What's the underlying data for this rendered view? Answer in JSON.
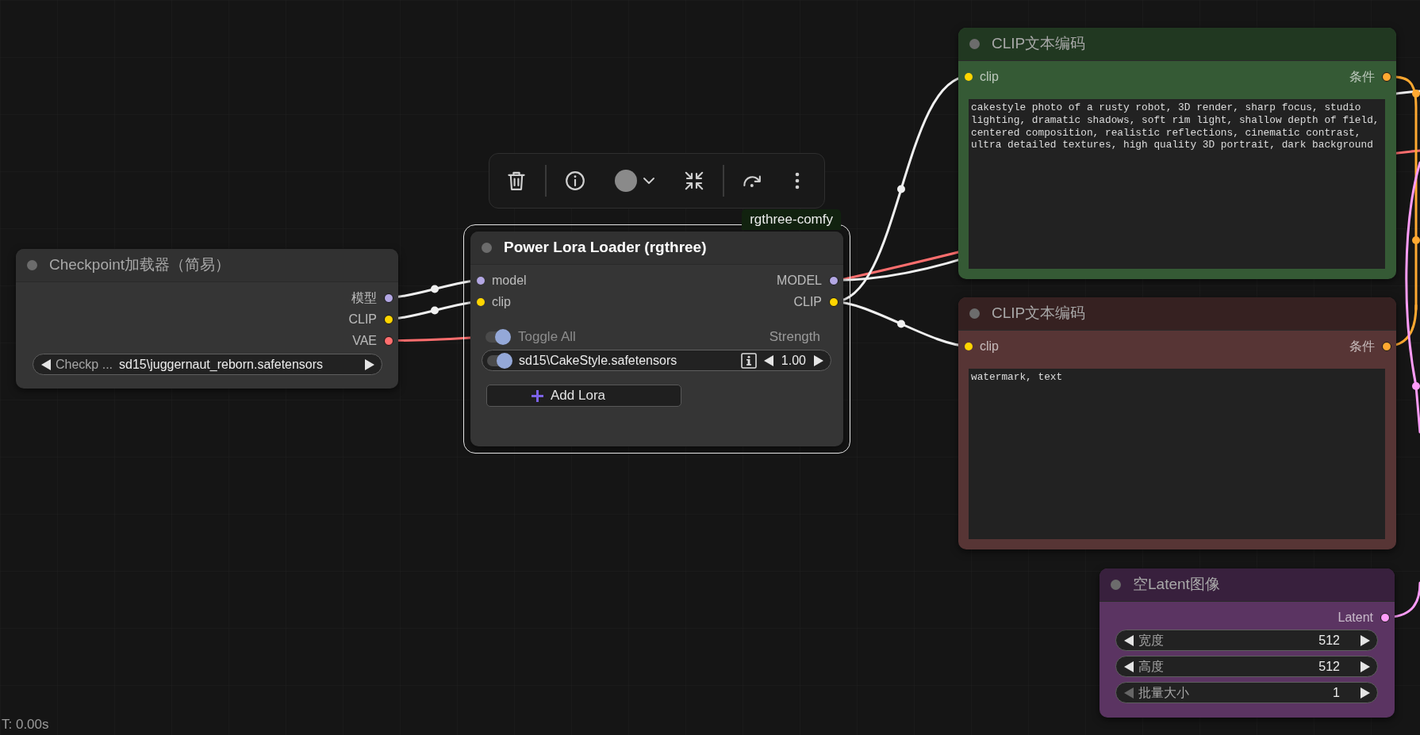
{
  "nodes": [
    {
      "title": "Checkpoint加载器（简易）",
      "selected": false,
      "outputs": [
        {
          "label": "模型",
          "color": "#b3a7e3"
        },
        {
          "label": "CLIP",
          "color": "#ffd500"
        },
        {
          "label": "VAE",
          "color": "#ff6e6e"
        }
      ],
      "widgets": [
        {
          "kind": "combo",
          "label": "Checkp ...",
          "value": "sd15\\juggernaut_reborn.safetensors"
        }
      ]
    },
    {
      "title": "Power Lora Loader (rgthree)",
      "selected": true,
      "badge": "rgthree-comfy",
      "inputs": [
        {
          "label": "model",
          "color": "#b3a7e3"
        },
        {
          "label": "clip",
          "color": "#ffd500"
        }
      ],
      "outputs": [
        {
          "label": "MODEL",
          "color": "#b3a7e3"
        },
        {
          "label": "CLIP",
          "color": "#ffd500"
        }
      ],
      "widgets": [
        {
          "kind": "toggle_all",
          "label": "Toggle All",
          "on": true,
          "column": "Strength"
        },
        {
          "kind": "lora",
          "on": true,
          "name": "sd15\\CakeStyle.safetensors",
          "strength": "1.00"
        },
        {
          "kind": "button",
          "label": "Add Lora"
        }
      ]
    },
    {
      "title": "CLIP文本编码",
      "color": "#355a35",
      "selected": false,
      "inputs": [
        {
          "label": "clip",
          "color": "#ffd500"
        }
      ],
      "outputs": [
        {
          "label": "条件",
          "color": "#ffa931"
        }
      ],
      "widgets": [
        {
          "kind": "textarea",
          "value": "cakestyle photo of a rusty robot, 3D render, sharp focus, studio lighting, dramatic shadows, soft rim light, shallow depth of field, centered composition, realistic reflections, cinematic contrast, ultra detailed textures, high quality 3D portrait, dark background"
        }
      ]
    },
    {
      "title": "CLIP文本编码",
      "color": "#573535",
      "selected": false,
      "inputs": [
        {
          "label": "clip",
          "color": "#ffd500"
        }
      ],
      "outputs": [
        {
          "label": "条件",
          "color": "#ffa931"
        }
      ],
      "widgets": [
        {
          "kind": "textarea",
          "value": "watermark, text"
        }
      ]
    },
    {
      "title": "空Latent图像",
      "color": "#5b3462",
      "selected": false,
      "outputs": [
        {
          "label": "Latent",
          "color": "#ff9cf9"
        }
      ],
      "widgets": [
        {
          "kind": "number",
          "label": "宽度",
          "value": "512",
          "decrement_disabled": false
        },
        {
          "kind": "number",
          "label": "高度",
          "value": "512",
          "decrement_disabled": false
        },
        {
          "kind": "number",
          "label": "批量大小",
          "value": "1",
          "decrement_disabled": true
        }
      ]
    }
  ],
  "status": {
    "render_time": "T: 0.00s"
  }
}
